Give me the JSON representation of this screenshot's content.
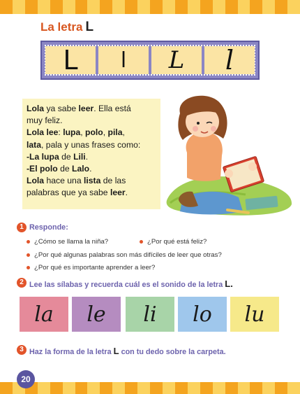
{
  "title": {
    "prefix": "La letra",
    "letter": "L"
  },
  "letter_forms": [
    "L",
    "l",
    "L",
    "l"
  ],
  "story": {
    "lines": [
      [
        {
          "t": "Lola",
          "b": true
        },
        {
          "t": " ya sabe ",
          "b": false
        },
        {
          "t": "leer",
          "b": true
        },
        {
          "t": ". Ella está",
          "b": false
        }
      ],
      [
        {
          "t": "muy feliz.",
          "b": false
        }
      ],
      [
        {
          "t": "Lola",
          "b": true
        },
        {
          "t": " ",
          "b": false
        },
        {
          "t": "lee",
          "b": true
        },
        {
          "t": ": ",
          "b": false
        },
        {
          "t": "lupa",
          "b": true
        },
        {
          "t": ", ",
          "b": false
        },
        {
          "t": "polo",
          "b": true
        },
        {
          "t": ", ",
          "b": false
        },
        {
          "t": "pila",
          "b": true
        },
        {
          "t": ",",
          "b": false
        }
      ],
      [
        {
          "t": "lata",
          "b": true
        },
        {
          "t": ", pala y unas frases como:",
          "b": false
        }
      ],
      [
        {
          "t": "-La lupa",
          "b": true
        },
        {
          "t": " de ",
          "b": false
        },
        {
          "t": "Lili",
          "b": true
        },
        {
          "t": ".",
          "b": false
        }
      ],
      [
        {
          "t": "-El polo",
          "b": true
        },
        {
          "t": " de ",
          "b": false
        },
        {
          "t": "Lalo",
          "b": true
        },
        {
          "t": ".",
          "b": false
        }
      ],
      [
        {
          "t": "Lola",
          "b": true
        },
        {
          "t": " hace una ",
          "b": false
        },
        {
          "t": "lista",
          "b": true
        },
        {
          "t": " de las",
          "b": false
        }
      ],
      [
        {
          "t": "palabras que ya sabe ",
          "b": false
        },
        {
          "t": "leer",
          "b": true
        },
        {
          "t": ".",
          "b": false
        }
      ]
    ]
  },
  "section1": {
    "number": "1",
    "label": "Responde:",
    "questions": [
      "¿Cómo se llama la niña?",
      "¿Por qué está feliz?",
      "¿Por qué algunas palabras son más difíciles de leer que otras?",
      "¿Por qué es importante aprender a leer?"
    ]
  },
  "section2": {
    "number": "2",
    "text": "Lee las sílabas y recuerda cuál es el sonido de la letra",
    "letter": "L."
  },
  "syllables": [
    {
      "text": "la",
      "color": "#e58a9a"
    },
    {
      "text": "le",
      "color": "#b58cc0"
    },
    {
      "text": "li",
      "color": "#a8d4a8"
    },
    {
      "text": "lo",
      "color": "#9fc7ec"
    },
    {
      "text": "lu",
      "color": "#f6e98a"
    }
  ],
  "section3": {
    "number": "3",
    "text_before": "Haz la forma de la letra",
    "letter": "L",
    "text_after": "con tu dedo sobre la carpeta."
  },
  "page_number": "20",
  "colors": {
    "stripe_a": "#f4a41f",
    "stripe_b": "#fbd25e",
    "accent": "#e2542a",
    "purple": "#6d63ad"
  }
}
